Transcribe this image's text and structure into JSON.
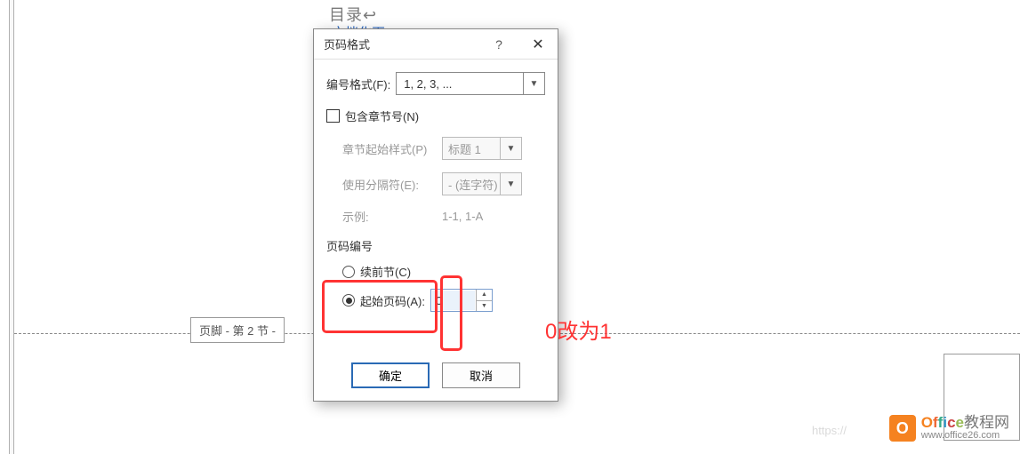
{
  "doc": {
    "heading": "目录↩",
    "link": "文档化页..."
  },
  "footer_section": "页脚 - 第 2 节 -",
  "dialog": {
    "title": "页码格式",
    "number_format_label": "编号格式(F):",
    "number_format_value": "1, 2, 3, ...",
    "include_chapter_label": "包含章节号(N)",
    "chapter_style_label": "章节起始样式(P)",
    "chapter_style_value": "标题 1",
    "separator_label": "使用分隔符(E):",
    "separator_value": "- (连字符)",
    "example_label": "示例:",
    "example_value": "1-1, 1-A",
    "page_numbering_label": "页码编号",
    "continue_label": "续前节(C)",
    "start_at_label": "起始页码(A):",
    "start_at_value": "0",
    "ok_label": "确定",
    "cancel_label": "取消"
  },
  "annotation": "0改为1",
  "logo": {
    "main": "Office",
    "rest": "教程网",
    "sub": "www.office26.com"
  },
  "faded_url": "https://"
}
